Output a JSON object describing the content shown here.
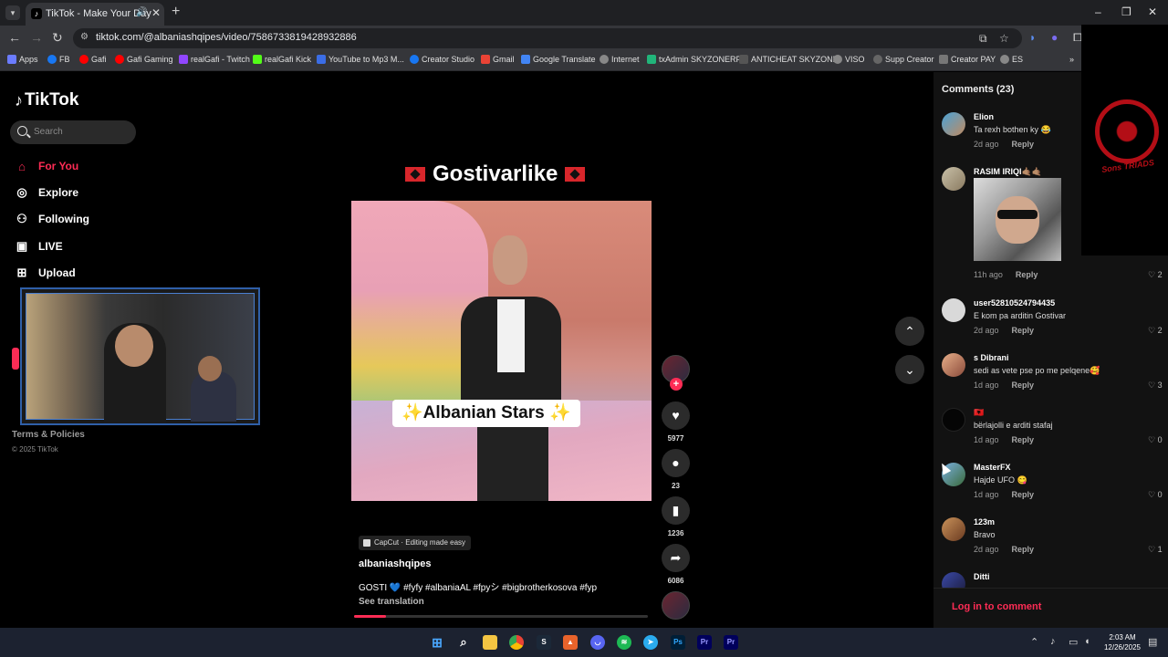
{
  "browser": {
    "tab_title": "TikTok - Make Your Day",
    "url": "tiktok.com/@albaniashqipes/video/7586733819428932886",
    "bookmarks": [
      "Apps",
      "FB",
      "Gafi",
      "Gafi Gaming",
      "realGafi - Twitch",
      "realGafi Kick",
      "YouTube to Mp3 M...",
      "Creator Studio",
      "Gmail",
      "Google Translate",
      "Internet",
      "txAdmin SKYZONERP",
      "ANTICHEAT SKYZONE",
      "VISO",
      "Supp Creator",
      "Creator PAY",
      "ES"
    ]
  },
  "tiktok": {
    "logo": "TikTok",
    "search_placeholder": "Search",
    "nav": [
      {
        "label": "For You",
        "icon": "home-icon",
        "active": true
      },
      {
        "label": "Explore",
        "icon": "compass-icon"
      },
      {
        "label": "Following",
        "icon": "following-icon"
      },
      {
        "label": "LIVE",
        "icon": "live-icon"
      },
      {
        "label": "Upload",
        "icon": "upload-icon"
      }
    ],
    "footer_terms": "Terms & Policies",
    "footer_copyright": "© 2025 TikTok"
  },
  "video": {
    "title": "Gostivarlike",
    "caption_overlay": "✨Albanian Stars ✨",
    "capcut_label": "CapCut · Editing made easy",
    "author": "albaniashqipes",
    "description": "GOSTI 💙 #fyfy #albaniaAL #fpyシ #bigbrotherkosova #fyp",
    "see_translation": "See translation",
    "progress": 0.11,
    "likes": "5977",
    "comments": "23",
    "saves": "1236",
    "shares": "6086"
  },
  "comments_panel": {
    "header": "Comments (23)",
    "login": "Log in to comment",
    "reply_label": "Reply",
    "items": [
      {
        "name": "Elion",
        "text": "Ta rexh bothen ky 😂",
        "time": "2d ago",
        "likes": ""
      },
      {
        "name": "RASIM IRIQI🤙🏽🤙🏽",
        "text": "",
        "time": "11h ago",
        "likes": "2",
        "has_image": true
      },
      {
        "name": "user52810524794435",
        "text": "E kom pa arditin Gostivar",
        "time": "2d ago",
        "likes": "2"
      },
      {
        "name": "s Dibrani",
        "text": "sedi as vete pse po me pelqene🥰",
        "time": "1d ago",
        "likes": "3"
      },
      {
        "name": "🇦🇱",
        "text": "bërlajolli e arditi stafaj",
        "time": "1d ago",
        "likes": "0"
      },
      {
        "name": "MasterFX",
        "text": "Hajde UFO 😋",
        "time": "1d ago",
        "likes": "0"
      },
      {
        "name": "123m",
        "text": "Bravo",
        "time": "2d ago",
        "likes": "1"
      },
      {
        "name": "Ditti",
        "text": "",
        "time": "",
        "likes": ""
      }
    ]
  },
  "overlay": {
    "emblem_text": "Sons TRIADS"
  },
  "taskbar": {
    "time": "2:03 AM",
    "date": "12/26/2025"
  }
}
